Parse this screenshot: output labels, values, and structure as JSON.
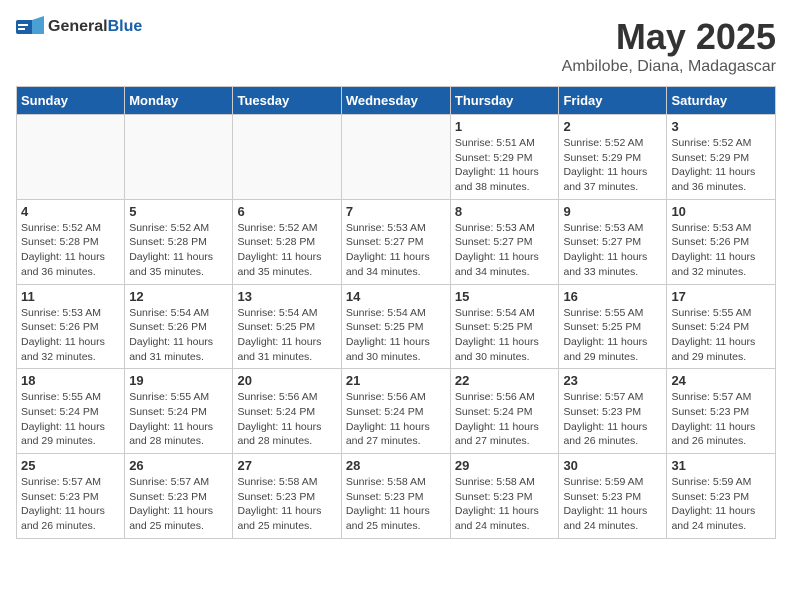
{
  "header": {
    "logo_general": "General",
    "logo_blue": "Blue",
    "month_year": "May 2025",
    "location": "Ambilobe, Diana, Madagascar"
  },
  "days_of_week": [
    "Sunday",
    "Monday",
    "Tuesday",
    "Wednesday",
    "Thursday",
    "Friday",
    "Saturday"
  ],
  "weeks": [
    [
      {
        "day": "",
        "info": ""
      },
      {
        "day": "",
        "info": ""
      },
      {
        "day": "",
        "info": ""
      },
      {
        "day": "",
        "info": ""
      },
      {
        "day": "1",
        "info": "Sunrise: 5:51 AM\nSunset: 5:29 PM\nDaylight: 11 hours\nand 38 minutes."
      },
      {
        "day": "2",
        "info": "Sunrise: 5:52 AM\nSunset: 5:29 PM\nDaylight: 11 hours\nand 37 minutes."
      },
      {
        "day": "3",
        "info": "Sunrise: 5:52 AM\nSunset: 5:29 PM\nDaylight: 11 hours\nand 36 minutes."
      }
    ],
    [
      {
        "day": "4",
        "info": "Sunrise: 5:52 AM\nSunset: 5:28 PM\nDaylight: 11 hours\nand 36 minutes."
      },
      {
        "day": "5",
        "info": "Sunrise: 5:52 AM\nSunset: 5:28 PM\nDaylight: 11 hours\nand 35 minutes."
      },
      {
        "day": "6",
        "info": "Sunrise: 5:52 AM\nSunset: 5:28 PM\nDaylight: 11 hours\nand 35 minutes."
      },
      {
        "day": "7",
        "info": "Sunrise: 5:53 AM\nSunset: 5:27 PM\nDaylight: 11 hours\nand 34 minutes."
      },
      {
        "day": "8",
        "info": "Sunrise: 5:53 AM\nSunset: 5:27 PM\nDaylight: 11 hours\nand 34 minutes."
      },
      {
        "day": "9",
        "info": "Sunrise: 5:53 AM\nSunset: 5:27 PM\nDaylight: 11 hours\nand 33 minutes."
      },
      {
        "day": "10",
        "info": "Sunrise: 5:53 AM\nSunset: 5:26 PM\nDaylight: 11 hours\nand 32 minutes."
      }
    ],
    [
      {
        "day": "11",
        "info": "Sunrise: 5:53 AM\nSunset: 5:26 PM\nDaylight: 11 hours\nand 32 minutes."
      },
      {
        "day": "12",
        "info": "Sunrise: 5:54 AM\nSunset: 5:26 PM\nDaylight: 11 hours\nand 31 minutes."
      },
      {
        "day": "13",
        "info": "Sunrise: 5:54 AM\nSunset: 5:25 PM\nDaylight: 11 hours\nand 31 minutes."
      },
      {
        "day": "14",
        "info": "Sunrise: 5:54 AM\nSunset: 5:25 PM\nDaylight: 11 hours\nand 30 minutes."
      },
      {
        "day": "15",
        "info": "Sunrise: 5:54 AM\nSunset: 5:25 PM\nDaylight: 11 hours\nand 30 minutes."
      },
      {
        "day": "16",
        "info": "Sunrise: 5:55 AM\nSunset: 5:25 PM\nDaylight: 11 hours\nand 29 minutes."
      },
      {
        "day": "17",
        "info": "Sunrise: 5:55 AM\nSunset: 5:24 PM\nDaylight: 11 hours\nand 29 minutes."
      }
    ],
    [
      {
        "day": "18",
        "info": "Sunrise: 5:55 AM\nSunset: 5:24 PM\nDaylight: 11 hours\nand 29 minutes."
      },
      {
        "day": "19",
        "info": "Sunrise: 5:55 AM\nSunset: 5:24 PM\nDaylight: 11 hours\nand 28 minutes."
      },
      {
        "day": "20",
        "info": "Sunrise: 5:56 AM\nSunset: 5:24 PM\nDaylight: 11 hours\nand 28 minutes."
      },
      {
        "day": "21",
        "info": "Sunrise: 5:56 AM\nSunset: 5:24 PM\nDaylight: 11 hours\nand 27 minutes."
      },
      {
        "day": "22",
        "info": "Sunrise: 5:56 AM\nSunset: 5:24 PM\nDaylight: 11 hours\nand 27 minutes."
      },
      {
        "day": "23",
        "info": "Sunrise: 5:57 AM\nSunset: 5:23 PM\nDaylight: 11 hours\nand 26 minutes."
      },
      {
        "day": "24",
        "info": "Sunrise: 5:57 AM\nSunset: 5:23 PM\nDaylight: 11 hours\nand 26 minutes."
      }
    ],
    [
      {
        "day": "25",
        "info": "Sunrise: 5:57 AM\nSunset: 5:23 PM\nDaylight: 11 hours\nand 26 minutes."
      },
      {
        "day": "26",
        "info": "Sunrise: 5:57 AM\nSunset: 5:23 PM\nDaylight: 11 hours\nand 25 minutes."
      },
      {
        "day": "27",
        "info": "Sunrise: 5:58 AM\nSunset: 5:23 PM\nDaylight: 11 hours\nand 25 minutes."
      },
      {
        "day": "28",
        "info": "Sunrise: 5:58 AM\nSunset: 5:23 PM\nDaylight: 11 hours\nand 25 minutes."
      },
      {
        "day": "29",
        "info": "Sunrise: 5:58 AM\nSunset: 5:23 PM\nDaylight: 11 hours\nand 24 minutes."
      },
      {
        "day": "30",
        "info": "Sunrise: 5:59 AM\nSunset: 5:23 PM\nDaylight: 11 hours\nand 24 minutes."
      },
      {
        "day": "31",
        "info": "Sunrise: 5:59 AM\nSunset: 5:23 PM\nDaylight: 11 hours\nand 24 minutes."
      }
    ]
  ]
}
